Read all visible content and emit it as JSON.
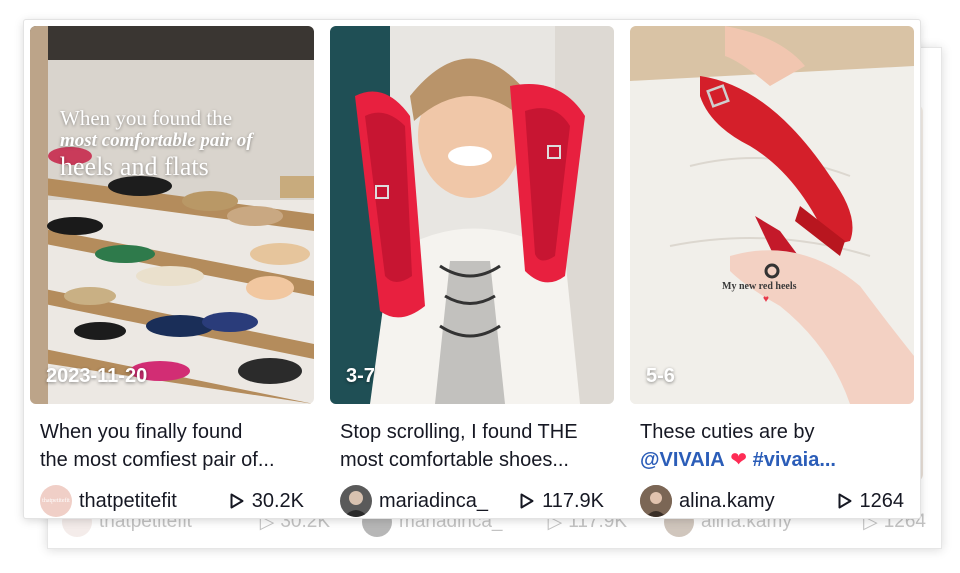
{
  "cards": [
    {
      "thumb_label": "2023-11-20",
      "overlay": [
        "When you found the",
        "most comfortable pair of",
        "heels and flats"
      ],
      "caption_line1": "When you finally found",
      "caption_line2": "the most comfiest pair of...",
      "author": "thatpetitefit",
      "avatar_text": "thatpetitefit",
      "plays": "30.2K",
      "colors": {
        "shelf": "#f2ede6",
        "wood": "#b08a5a"
      }
    },
    {
      "thumb_label": "3-7",
      "caption_line1": "Stop scrolling, I found THE",
      "caption_line2": "most comfortable shoes...",
      "author": "mariadinca_",
      "plays": "117.9K",
      "colors": {
        "shoe": "#e8203f",
        "bg": "#1f4f55"
      }
    },
    {
      "thumb_label": "5-6",
      "mini_caption": "My new red heels",
      "caption_line1": "These cuties are by",
      "caption_mention": "@VIVAIA",
      "caption_hashtag": "#vivaia...",
      "author": "alina.kamy",
      "plays": "1264",
      "colors": {
        "shoe": "#d41f2a",
        "bg": "#ece9e3"
      }
    }
  ],
  "ghost_row": [
    {
      "author": "thatpetitefit",
      "plays": "30.2K"
    },
    {
      "author": "mariadinca_",
      "plays": "117.9K"
    },
    {
      "author": "alina.kamy",
      "plays": "1264"
    }
  ],
  "icons": {
    "play": "play-icon",
    "heart": "heart-icon"
  },
  "accent_colors": {
    "hashtag": "#2b5db8",
    "heart": "#fe2c55"
  }
}
